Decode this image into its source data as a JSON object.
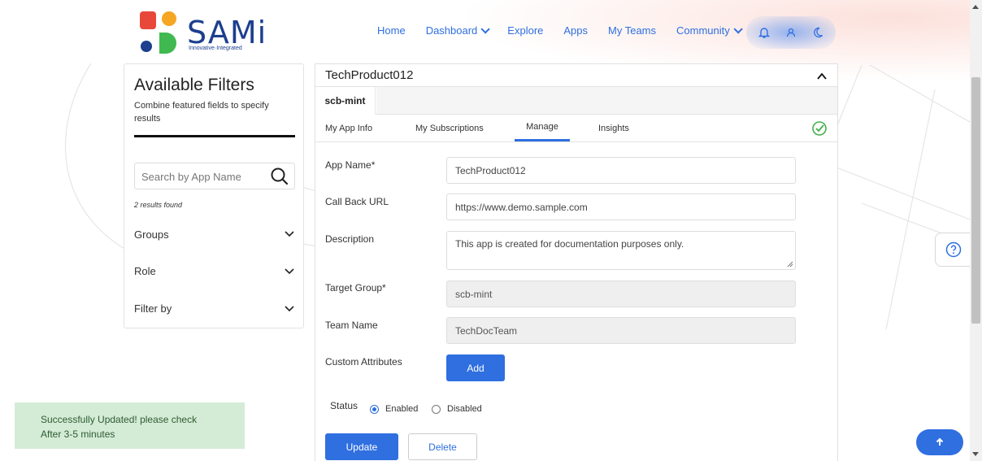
{
  "header": {
    "logo_text": "SAMi",
    "logo_subtext": "Innovative·Integrated",
    "nav": [
      {
        "label": "Home"
      },
      {
        "label": "Dashboard"
      },
      {
        "label": "Explore"
      },
      {
        "label": "Apps"
      },
      {
        "label": "My Teams"
      },
      {
        "label": "Community"
      }
    ],
    "icons": [
      "bell-icon",
      "user-icon",
      "moon-icon"
    ]
  },
  "filters": {
    "title": "Available Filters",
    "subtitle": "Combine featured fields to specify results",
    "search_placeholder": "Search by App Name",
    "results_found": "2 results found",
    "items": [
      {
        "label": "Groups"
      },
      {
        "label": "Role"
      },
      {
        "label": "Filter by"
      }
    ]
  },
  "card": {
    "title": "TechProduct012",
    "subhead_tab": "scb-mint",
    "tabs": [
      {
        "label": "My App Info"
      },
      {
        "label": "My Subscriptions"
      },
      {
        "label": "Manage"
      },
      {
        "label": "Insights"
      }
    ],
    "active_tab": "Manage",
    "form": {
      "app_name_label": "App Name*",
      "app_name_value": "TechProduct012",
      "callback_label": "Call Back URL",
      "callback_value": "https://www.demo.sample.com",
      "description_label": "Description",
      "description_value": "This app is created for documentation purposes only.",
      "target_group_label": "Target Group*",
      "target_group_value": "scb-mint",
      "team_name_label": "Team Name",
      "team_name_value": "TechDocTeam",
      "custom_attributes_label": "Custom Attributes",
      "add_label": "Add",
      "status_label": "Status",
      "status_options": [
        {
          "label": "Enabled",
          "selected": true
        },
        {
          "label": "Disabled",
          "selected": false
        }
      ],
      "update_label": "Update",
      "delete_label": "Delete"
    }
  },
  "toast": {
    "line1": "Successfully Updated! please check",
    "line2": "After 3-5 minutes"
  },
  "colors": {
    "accent": "#2f6fe0",
    "logo_blue": "#1c3f8e",
    "logo_red": "#e8483a",
    "logo_orange": "#f5a623",
    "logo_green": "#3fb950",
    "toast_bg": "#d4ecd6"
  }
}
